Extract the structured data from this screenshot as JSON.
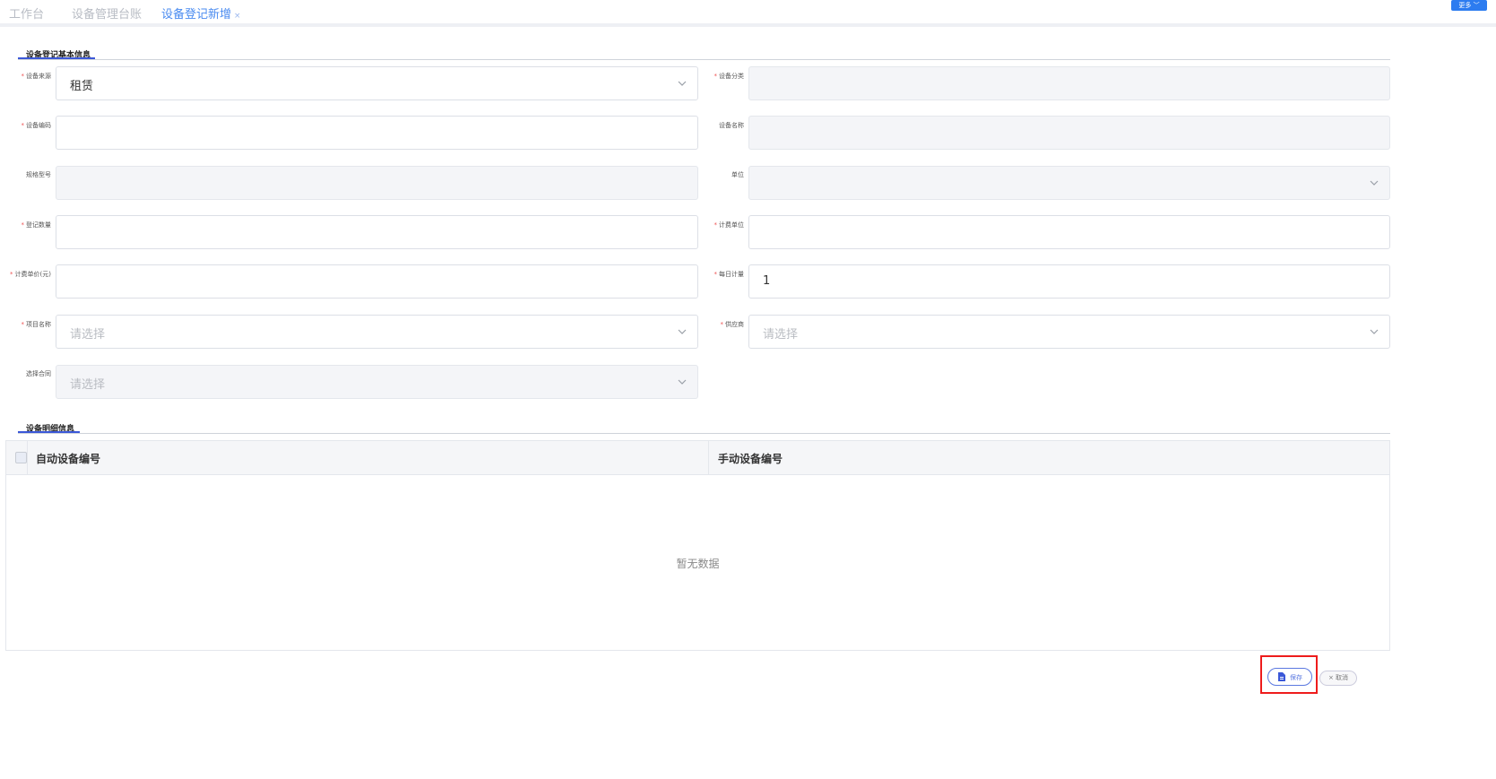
{
  "tabs": [
    {
      "label": "工作台"
    },
    {
      "label": "设备管理台账"
    },
    {
      "label": "设备登记新增",
      "close": "×"
    }
  ],
  "more_label": "更多 ﹀",
  "basic_section": {
    "title": "设备登记基本信息"
  },
  "fields": {
    "source": {
      "label": "设备来源",
      "required": true,
      "value": "租赁",
      "placeholder": ""
    },
    "category": {
      "label": "设备分类",
      "required": false,
      "value": "",
      "placeholder": ""
    },
    "code": {
      "label": "设备编码",
      "required": true,
      "value": "",
      "placeholder": ""
    },
    "name": {
      "label": "设备名称",
      "required": false,
      "value": "",
      "placeholder": ""
    },
    "spec": {
      "label": "规格型号",
      "required": false,
      "value": "",
      "placeholder": ""
    },
    "unit": {
      "label": "单位",
      "required": false,
      "value": "",
      "placeholder": ""
    },
    "reg_qty": {
      "label": "登记数量",
      "required": true,
      "value": "",
      "placeholder": ""
    },
    "bill_unit": {
      "label": "计费单位",
      "required": true,
      "value": "",
      "placeholder": ""
    },
    "bill_price": {
      "label": "计费单价(元)",
      "required": true,
      "value": "",
      "placeholder": ""
    },
    "daily_qty": {
      "label": "每日计量",
      "required": true,
      "value": "1",
      "placeholder": ""
    },
    "project": {
      "label": "项目名称",
      "required": true,
      "value": "",
      "placeholder": "请选择"
    },
    "supplier": {
      "label": "供应商",
      "required": true,
      "value": "",
      "placeholder": "请选择"
    },
    "contract": {
      "label": "选择合同",
      "required": false,
      "value": "",
      "placeholder": "请选择"
    }
  },
  "detail_section": {
    "title": "设备明细信息"
  },
  "table": {
    "columns": [
      "自动设备编号",
      "手动设备编号"
    ],
    "empty_text": "暂无数据"
  },
  "buttons": {
    "save": "保存",
    "cancel": "× 取消"
  },
  "colors": {
    "accent": "#3b58d8",
    "highlight": "#ee1c1c"
  }
}
